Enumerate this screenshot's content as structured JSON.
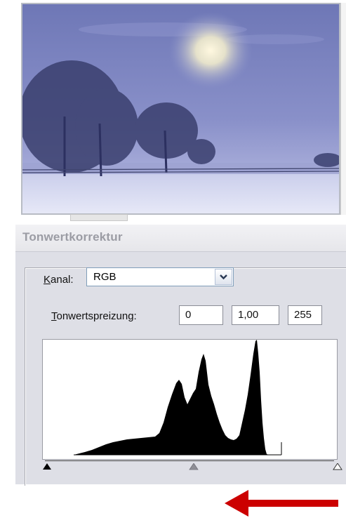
{
  "dialog": {
    "title": "Tonwertkorrektur",
    "channel": {
      "label_accel": "K",
      "label_rest": "anal:",
      "value": "RGB"
    },
    "input_levels": {
      "label_accel": "T",
      "label_rest": "onwertspreizung:",
      "black": "0",
      "gamma": "1,00",
      "white": "255"
    }
  },
  "colors": {
    "dialog_bg": "#dedfe6",
    "photo_sky": "#7d86c0",
    "snow": "#dfe1f4",
    "histogram_fill": "#000000",
    "arrow": "#cc0000"
  },
  "icons": {
    "dropdown": "chevron-down-icon",
    "black_point": "triangle-black-icon",
    "gray_point": "triangle-gray-icon",
    "white_point": "triangle-white-icon",
    "annotation": "arrow-left-icon"
  }
}
